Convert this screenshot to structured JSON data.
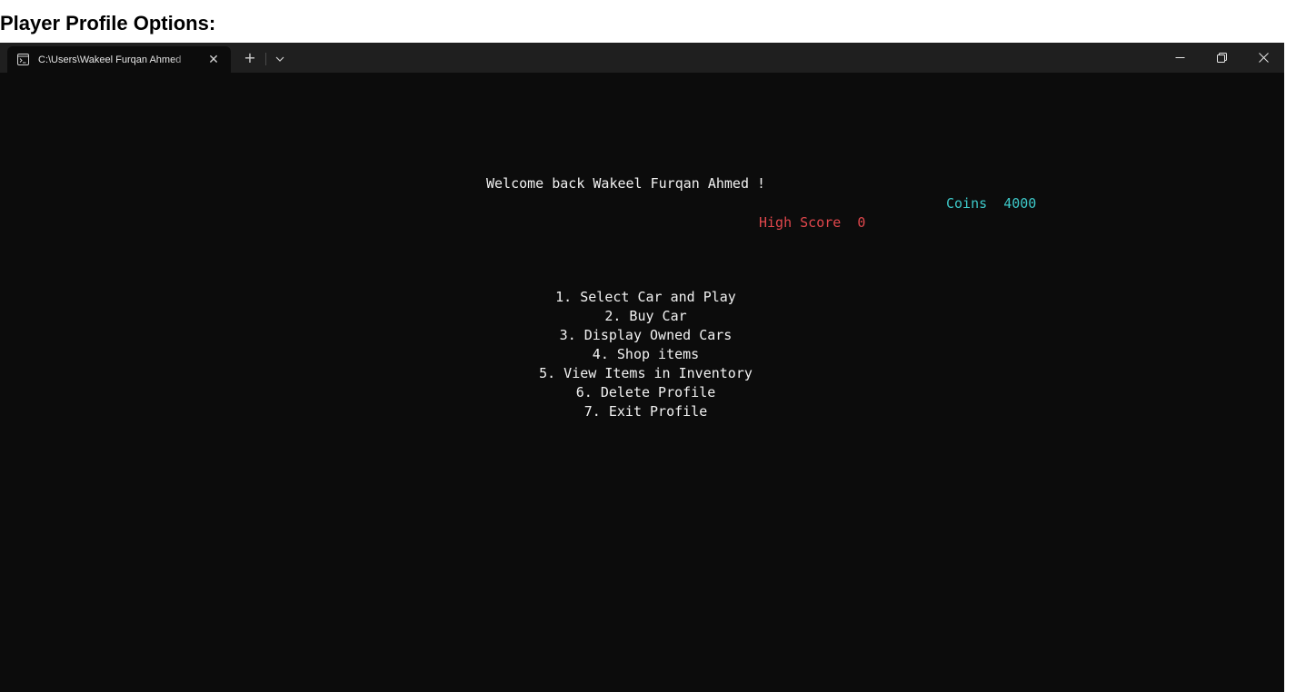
{
  "page": {
    "heading": "Player Profile Options:"
  },
  "window": {
    "tab_title": "C:\\Users\\Wakeel Furqan Ahmed",
    "tab_close_glyph": "✕",
    "new_tab_glyph": "+",
    "controls": [
      "minimize-icon",
      "restore-icon",
      "close-icon"
    ]
  },
  "console": {
    "welcome": "Welcome back Wakeel Furqan Ahmed !",
    "coins": "Coins  4000",
    "high_score": "High Score  0",
    "menu": [
      "1. Select Car and Play",
      "2. Buy Car",
      "3. Display Owned Cars",
      "4. Shop items",
      "5. View Items in Inventory",
      "6. Delete Profile",
      "7. Exit Profile"
    ]
  },
  "colors": {
    "background": "#0c0c0c",
    "titlebar": "#1f1f1f",
    "text": "#f2f2f2",
    "coins": "#3dc8c8",
    "high_score": "#e0474c"
  }
}
